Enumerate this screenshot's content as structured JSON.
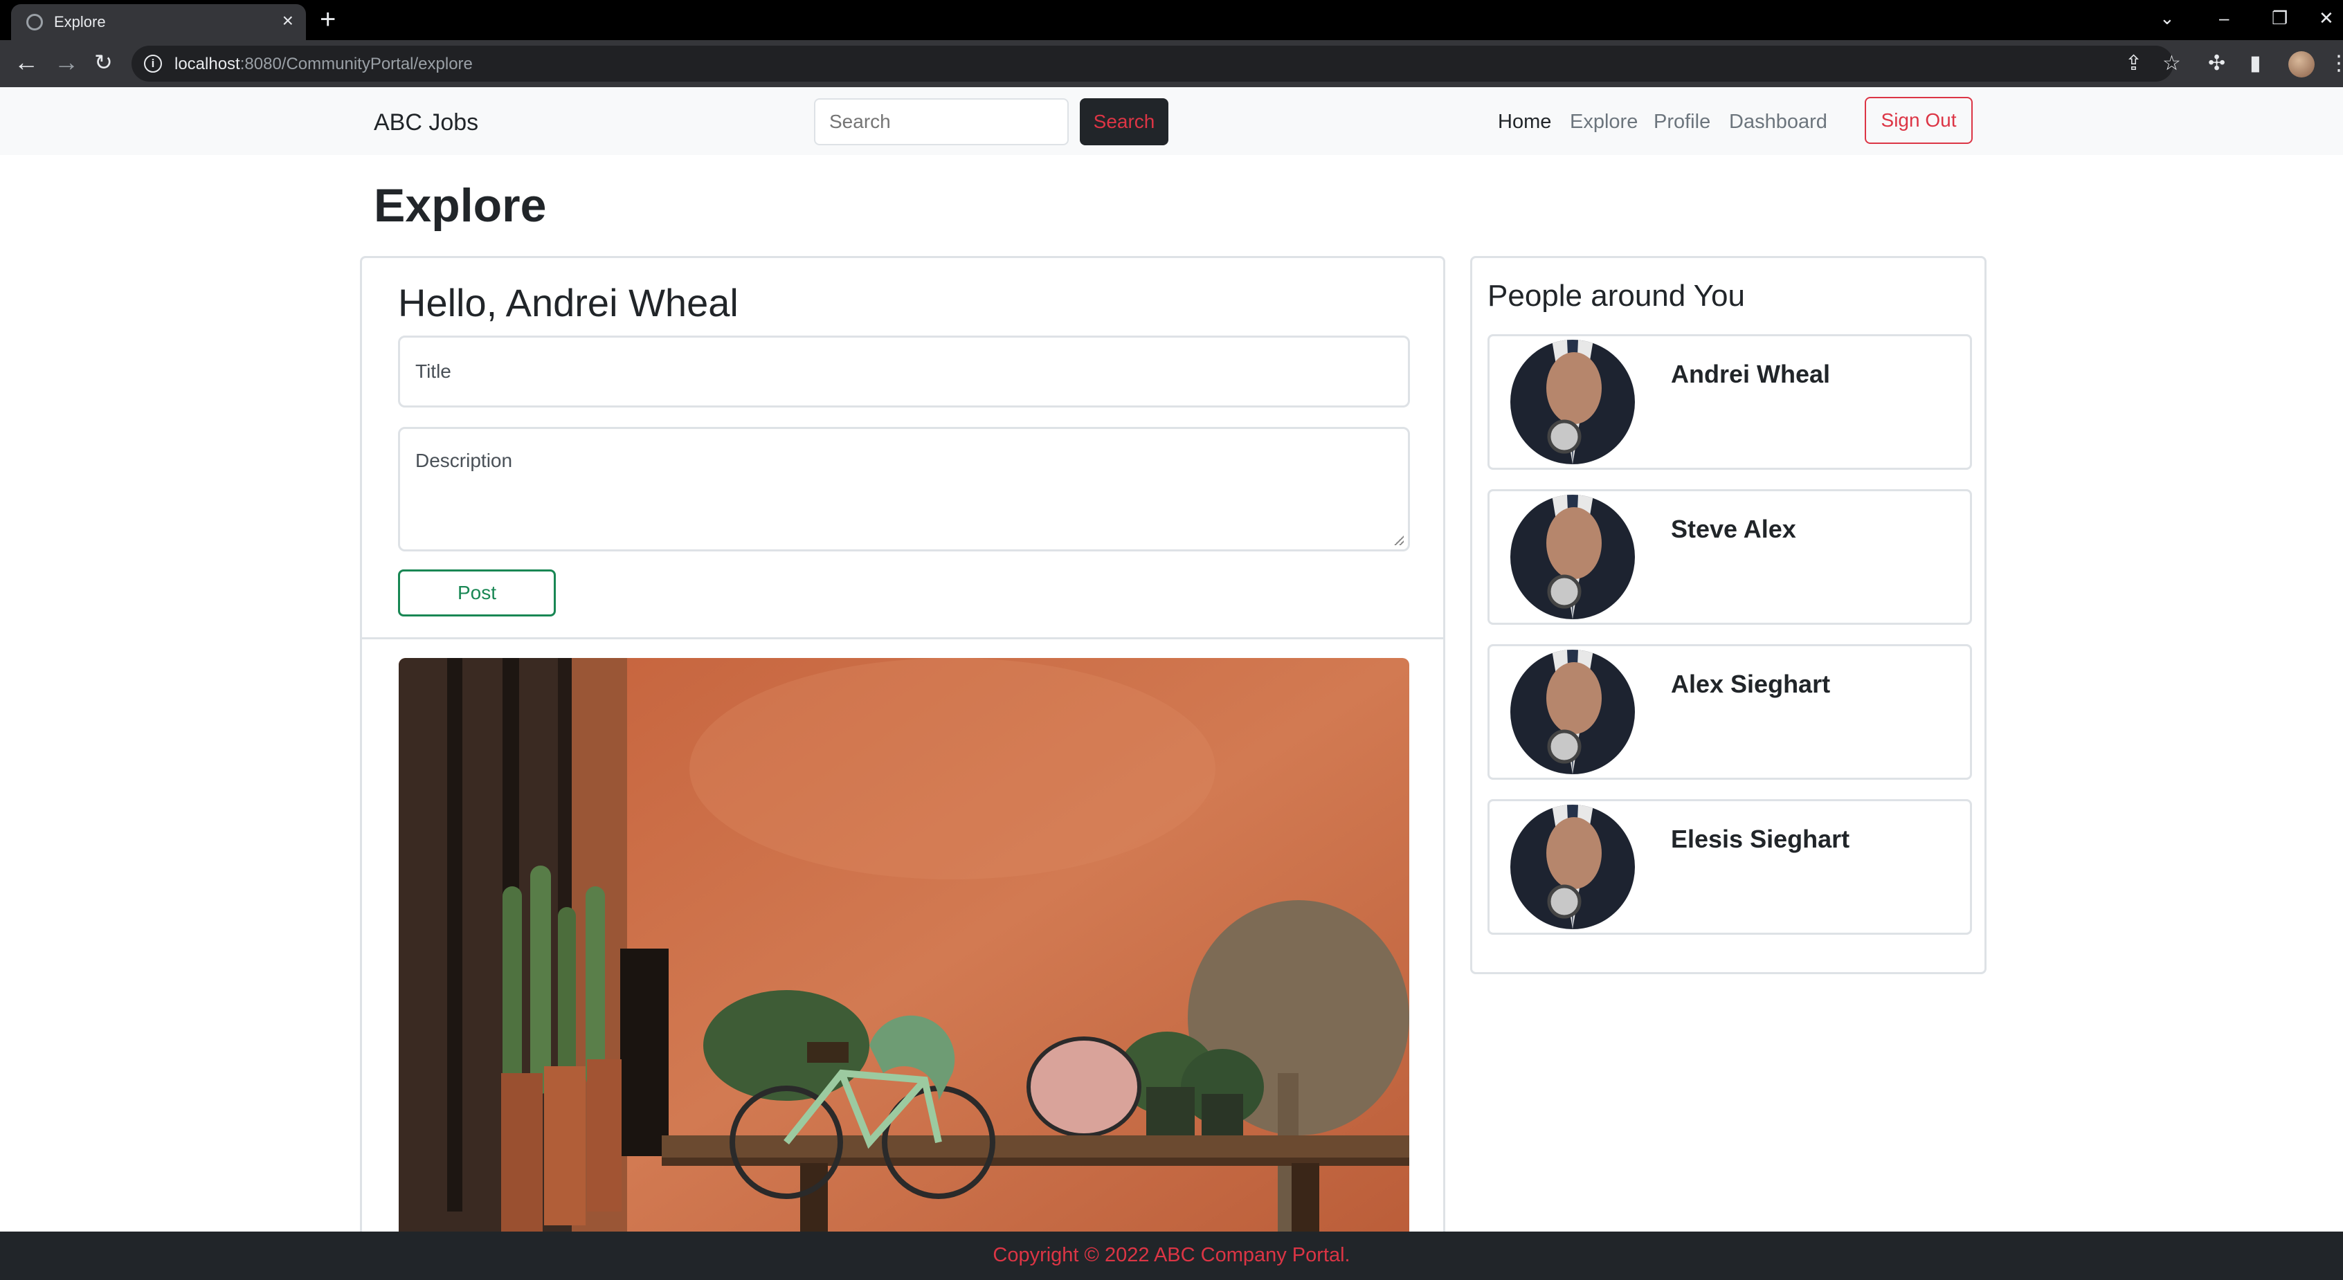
{
  "browser": {
    "tab_title": "Explore",
    "url_host": "localhost",
    "url_rest": ":8080/CommunityPortal/explore"
  },
  "navbar": {
    "brand": "ABC Jobs",
    "search_placeholder": "Search",
    "search_button": "Search",
    "links": [
      "Home",
      "Explore",
      "Profile",
      "Dashboard"
    ],
    "active_link": "Home",
    "signout": "Sign Out"
  },
  "page": {
    "heading": "Explore"
  },
  "composer": {
    "greeting": "Hello, Andrei Wheal",
    "title_placeholder": "Title",
    "description_placeholder": "Description",
    "post_button": "Post"
  },
  "people": {
    "heading": "People around You",
    "list": [
      {
        "name": "Andrei Wheal"
      },
      {
        "name": "Steve Alex"
      },
      {
        "name": "Alex Sieghart"
      },
      {
        "name": "Elesis Sieghart"
      }
    ]
  },
  "footer": {
    "text": "Copyright © 2022 ABC Company Portal."
  },
  "colors": {
    "danger": "#dc3545",
    "success": "#198754",
    "dark": "#212529",
    "navbar_bg": "#f8f9fa"
  },
  "icons": [
    "globe-icon",
    "close-icon",
    "plus-icon",
    "back-arrow-icon",
    "forward-arrow-icon",
    "reload-icon",
    "info-icon",
    "share-icon",
    "star-icon",
    "puzzle-icon",
    "sidebar-icon",
    "profile-avatar",
    "menu-dots-icon"
  ]
}
